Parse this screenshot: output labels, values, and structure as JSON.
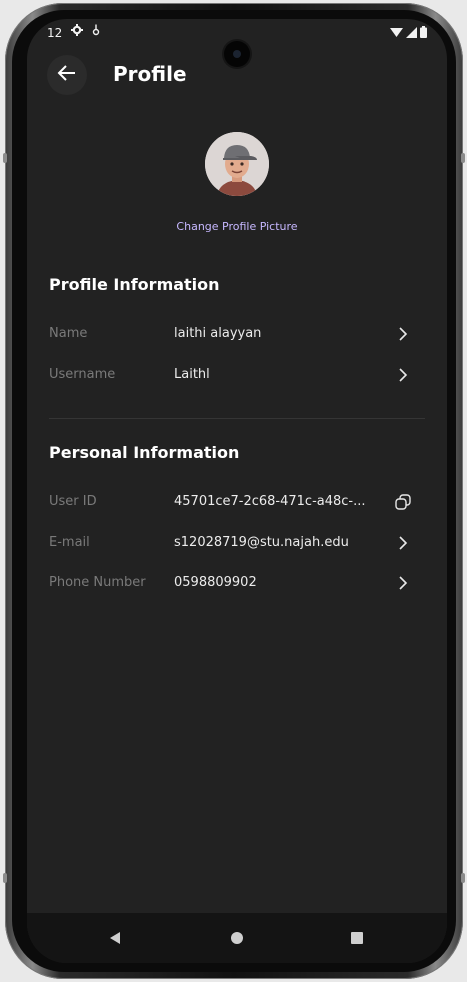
{
  "status_bar": {
    "time": "12",
    "icons_left": [
      "settings-gear",
      "usb-debug"
    ],
    "icons_right": [
      "wifi",
      "cellular",
      "battery"
    ]
  },
  "app_bar": {
    "back_icon": "arrow-left",
    "title": "Profile"
  },
  "avatar": {
    "icon": "avatar-illustration"
  },
  "change_picture_label": "Change Profile Picture",
  "profile_information": {
    "title": "Profile Information",
    "rows": [
      {
        "label": "Name",
        "value": "laithi alayyan",
        "action_icon": "chevron-right"
      },
      {
        "label": "Username",
        "value": "Laithl",
        "action_icon": "chevron-right"
      }
    ]
  },
  "personal_information": {
    "title": "Personal Information",
    "rows": [
      {
        "label": "User ID",
        "value": "45701ce7-2c68-471c-a48c-...",
        "action_icon": "copy"
      },
      {
        "label": "E-mail",
        "value": "s12028719@stu.najah.edu",
        "action_icon": "chevron-right"
      },
      {
        "label": "Phone Number",
        "value": "0598809902",
        "action_icon": "chevron-right"
      }
    ]
  },
  "nav_bar": {
    "buttons": [
      "back-triangle",
      "home-circle",
      "recents-square"
    ]
  },
  "colors": {
    "background": "#222222",
    "accent_link": "#c7b8ff",
    "label": "#7a7a7a",
    "value": "#ececec"
  }
}
